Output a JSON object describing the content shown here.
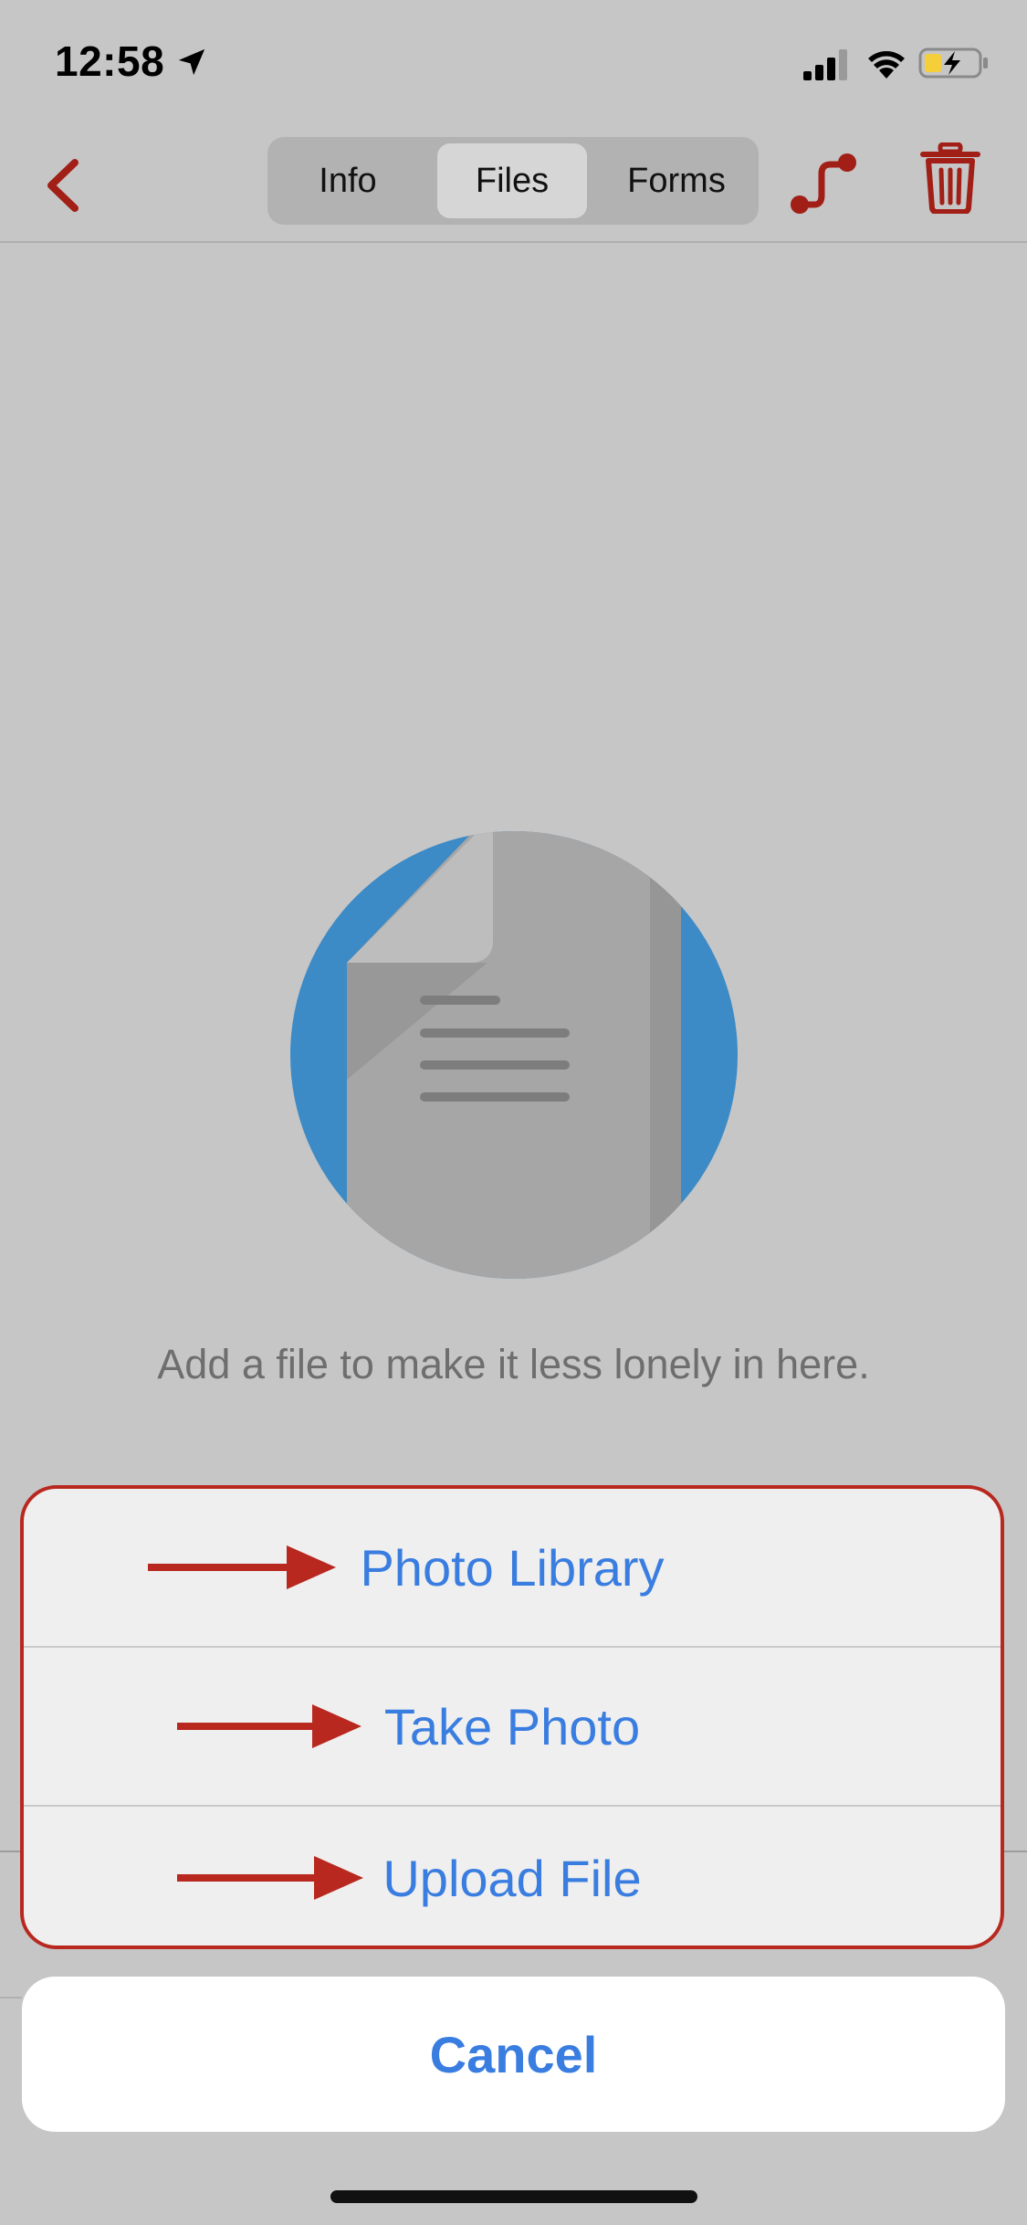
{
  "status_bar": {
    "time": "12:58",
    "icons": [
      "location-arrow-icon",
      "cellular-signal-icon",
      "wifi-icon",
      "battery-charging-icon"
    ]
  },
  "nav": {
    "back_icon": "chevron-left-icon",
    "tabs": [
      {
        "label": "Info",
        "selected": false
      },
      {
        "label": "Files",
        "selected": true
      },
      {
        "label": "Forms",
        "selected": false
      }
    ],
    "route_icon": "route-icon",
    "trash_icon": "trash-icon"
  },
  "empty_state": {
    "icon": "document-icon",
    "message": "Add a file to make it less lonely in here."
  },
  "action_sheet": {
    "items": [
      {
        "label": "Photo Library"
      },
      {
        "label": "Take Photo"
      },
      {
        "label": "Upload File"
      }
    ],
    "cancel_label": "Cancel"
  },
  "colors": {
    "accent_red": "#a11f16",
    "link_blue": "#3a7de0",
    "annotation_red": "#b8281f",
    "illustration_blue": "#3c8ac6"
  }
}
